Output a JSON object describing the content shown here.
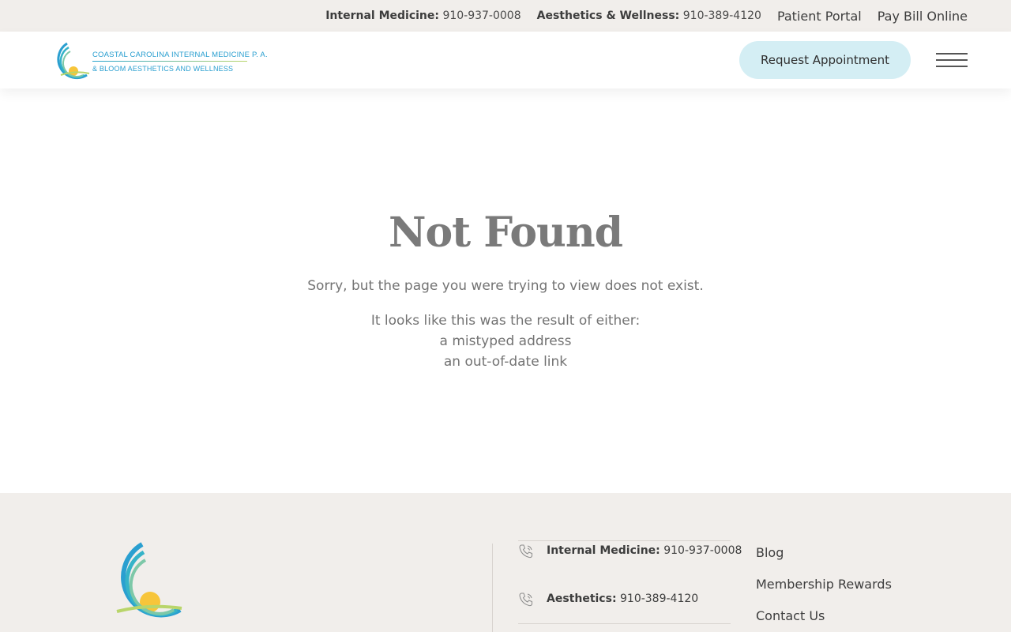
{
  "topbar": {
    "im_label": "Internal Medicine:",
    "im_phone": "910-937-0008",
    "aw_label": "Aesthetics & Wellness:",
    "aw_phone": "910-389-4120",
    "patient_portal": "Patient Portal",
    "pay_bill": "Pay Bill Online"
  },
  "header": {
    "logo_line1": "COASTAL CAROLINA INTERNAL MEDICINE P. A.",
    "logo_line2": "& BLOOM AESTHETICS AND WELLNESS",
    "request_appointment": "Request Appointment",
    "menu_icon": "hamburger-menu-icon"
  },
  "main": {
    "title": "Not Found",
    "message": "Sorry, but the page you were trying to view does not exist.",
    "reason_intro": "It looks like this was the result of either:",
    "reason_1": "a mistyped address",
    "reason_2": "an out-of-date link"
  },
  "footer": {
    "phones": [
      {
        "label": "Internal Medicine:",
        "number": "910-937-0008",
        "icon": "phone-icon"
      },
      {
        "label": "Aesthetics:",
        "number": "910-389-4120",
        "icon": "phone-icon"
      }
    ],
    "links": [
      "Blog",
      "Membership Rewards",
      "Contact Us"
    ]
  },
  "colors": {
    "topbar_bg": "#f1eeeb",
    "button_bg": "#d4eef4",
    "logo_blue": "#2a9fd0",
    "logo_green": "#b9d56a",
    "logo_sun": "#f7c53a"
  }
}
